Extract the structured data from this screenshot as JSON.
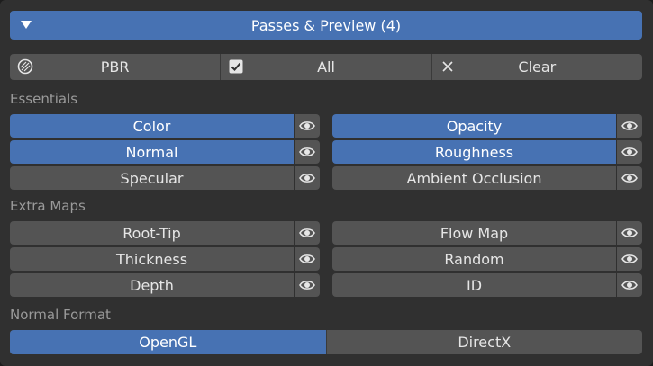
{
  "header": {
    "title": "Passes & Preview  (4)"
  },
  "toolbar": {
    "pbr_label": "PBR",
    "all_label": "All",
    "clear_label": "Clear"
  },
  "sections": {
    "essentials": "Essentials",
    "extra_maps": "Extra Maps",
    "normal_format": "Normal Format"
  },
  "essentials": {
    "left": [
      {
        "label": "Color",
        "enabled": true
      },
      {
        "label": "Normal",
        "enabled": true
      },
      {
        "label": "Specular",
        "enabled": false
      }
    ],
    "right": [
      {
        "label": "Opacity",
        "enabled": true
      },
      {
        "label": "Roughness",
        "enabled": true
      },
      {
        "label": "Ambient Occlusion",
        "enabled": false
      }
    ]
  },
  "extra_maps": {
    "left": [
      {
        "label": "Root-Tip",
        "enabled": false
      },
      {
        "label": "Thickness",
        "enabled": false
      },
      {
        "label": "Depth",
        "enabled": false
      }
    ],
    "right": [
      {
        "label": "Flow Map",
        "enabled": false
      },
      {
        "label": "Random",
        "enabled": false
      },
      {
        "label": "ID",
        "enabled": false
      }
    ]
  },
  "normal_format": {
    "options": [
      "OpenGL",
      "DirectX"
    ],
    "selected": "OpenGL"
  },
  "colors": {
    "accent": "#4772b3",
    "button": "#545454",
    "panel": "#303030"
  }
}
